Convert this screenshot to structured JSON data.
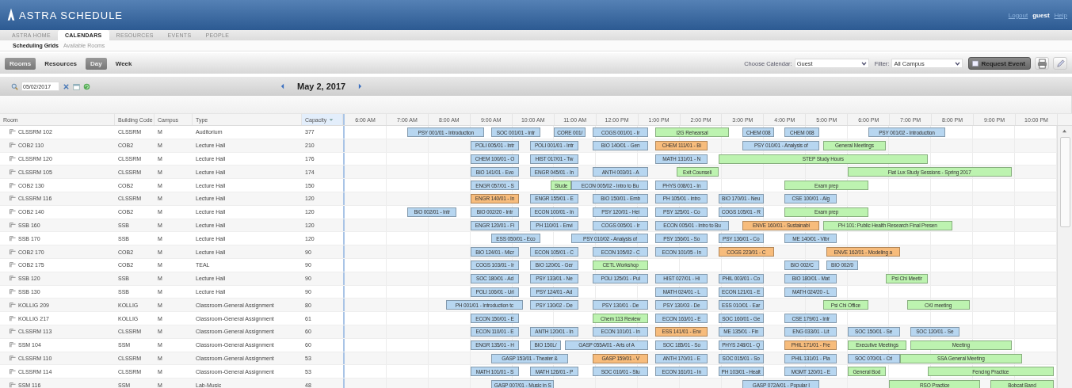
{
  "app": {
    "title": "ASTRA SCHEDULE"
  },
  "user": {
    "logout": "Logout",
    "name": "guest",
    "help": "Help"
  },
  "tabs": [
    {
      "label": "ASTRA HOME",
      "selected": false
    },
    {
      "label": "CALENDARS",
      "selected": true
    },
    {
      "label": "RESOURCES",
      "selected": false
    },
    {
      "label": "EVENTS",
      "selected": false
    },
    {
      "label": "PEOPLE",
      "selected": false
    }
  ],
  "subnav": [
    {
      "label": "Scheduling Grids",
      "selected": true
    },
    {
      "label": "Available Rooms",
      "selected": false
    }
  ],
  "toolbar": {
    "modes": [
      {
        "label": "Rooms",
        "selected": true
      },
      {
        "label": "Resources",
        "selected": false
      }
    ],
    "ranges": [
      {
        "label": "Day",
        "selected": true
      },
      {
        "label": "Week",
        "selected": false
      }
    ],
    "calendar_label": "Choose Calendar:",
    "calendar": "Guest",
    "filter_label": "Filter:",
    "filter": "All Campus",
    "request": "Request Event"
  },
  "date_field": "05/02/2017",
  "date_title": "May 2, 2017",
  "columns": [
    "Room",
    "Building Code",
    "Campus",
    "Type",
    "Capacity"
  ],
  "hours": [
    "6:00 AM",
    "7:00 AM",
    "8:00 AM",
    "9:00 AM",
    "10:00 AM",
    "11:00 AM",
    "12:00 PM",
    "1:00 PM",
    "2:00 PM",
    "3:00 PM",
    "4:00 PM",
    "5:00 PM",
    "6:00 PM",
    "7:00 PM",
    "8:00 PM",
    "9:00 PM",
    "10:00 PM"
  ],
  "rooms": [
    {
      "name": "CLSSRM 102",
      "building": "CLSSRM",
      "campus": "M",
      "type": "Auditorium",
      "capacity": "377",
      "events": [
        {
          "title": "PSY 001/01 - Introduction",
          "color": "#b7d6f0"
        },
        {
          "title": "SOC 001/01 - Intr",
          "color": "#b7d6f0"
        },
        {
          "title": "CORE 001/",
          "color": "#b7d6f0"
        },
        {
          "title": "COGS 001/01 - Ir",
          "color": "#b7d6f0"
        },
        {
          "title": "I2G Rehearsal",
          "color": "#bdf3b0"
        },
        {
          "title": "CHEM 008",
          "color": "#b7d6f0"
        },
        {
          "title": "CHEM 008",
          "color": "#b7d6f0"
        },
        {
          "title": "PSY 001/02 - Introduction",
          "color": "#b7d6f0"
        }
      ]
    },
    {
      "name": "COB2 110",
      "building": "COB2",
      "campus": "M",
      "type": "Lecture Hall",
      "capacity": "210",
      "events": [
        {
          "title": "POLI 005/01 - Intr",
          "color": "#b7d6f0"
        },
        {
          "title": "POLI 001/01 - Intr",
          "color": "#b7d6f0"
        },
        {
          "title": "BIO 140/01 - Gen",
          "color": "#b7d6f0"
        },
        {
          "title": "CHEM 111/01 - Bi",
          "color": "#f7bc7c"
        },
        {
          "title": "PSY 010/01 - Analysis of",
          "color": "#b7d6f0"
        },
        {
          "title": "General Meetings",
          "color": "#bdf3b0"
        }
      ]
    },
    {
      "name": "CLSSRM 120",
      "building": "CLSSRM",
      "campus": "M",
      "type": "Lecture Hall",
      "capacity": "176",
      "events": [
        {
          "title": "CHEM 100/01 - O",
          "color": "#b7d6f0"
        },
        {
          "title": "HIST 017/01 - Tw",
          "color": "#b7d6f0"
        },
        {
          "title": "MATH 131/01 - N",
          "color": "#b7d6f0"
        },
        {
          "title": "STEP Study Hours",
          "color": "#bdf3b0"
        }
      ]
    },
    {
      "name": "CLSSRM 105",
      "building": "CLSSRM",
      "campus": "M",
      "type": "Lecture Hall",
      "capacity": "174",
      "events": [
        {
          "title": "BIO 141/01 - Evo",
          "color": "#b7d6f0"
        },
        {
          "title": "ENGR 045/01 - In",
          "color": "#b7d6f0"
        },
        {
          "title": "ANTH 003/01 - A",
          "color": "#b7d6f0"
        },
        {
          "title": "Exit Counseli",
          "color": "#bdf3b0"
        },
        {
          "title": "Fiat Lux Study Sessions - Spring 2017",
          "color": "#bdf3b0"
        }
      ]
    },
    {
      "name": "COB2 130",
      "building": "COB2",
      "campus": "M",
      "type": "Lecture Hall",
      "capacity": "150",
      "events": [
        {
          "title": "ENGR 057/01 - S",
          "color": "#b7d6f0"
        },
        {
          "title": "Stude",
          "color": "#bdf3b0"
        },
        {
          "title": "ECON 005/02 - Intro to Bu",
          "color": "#b7d6f0"
        },
        {
          "title": "PHYS 008/01 - In",
          "color": "#b7d6f0"
        },
        {
          "title": "Exam prep",
          "color": "#bdf3b0"
        }
      ]
    },
    {
      "name": "CLSSRM 116",
      "building": "CLSSRM",
      "campus": "M",
      "type": "Lecture Hall",
      "capacity": "120",
      "events": [
        {
          "title": "ENGR 140/01 - In",
          "color": "#f7bc7c"
        },
        {
          "title": "ENGR 155/01 - E",
          "color": "#b7d6f0"
        },
        {
          "title": "BIO 150/01 - Emb",
          "color": "#b7d6f0"
        },
        {
          "title": "PH 105/01 - Intro",
          "color": "#b7d6f0"
        },
        {
          "title": "BIO 170/01 - Neu",
          "color": "#b7d6f0"
        },
        {
          "title": "CSE 100/01 - Alg",
          "color": "#b7d6f0"
        }
      ]
    },
    {
      "name": "COB2 140",
      "building": "COB2",
      "campus": "M",
      "type": "Lecture Hall",
      "capacity": "120",
      "events": [
        {
          "title": "BIO 002/01 - Intr",
          "color": "#b7d6f0"
        },
        {
          "title": "BIO 002/20 - Intr",
          "color": "#b7d6f0"
        },
        {
          "title": "ECON 100/01 - In",
          "color": "#b7d6f0"
        },
        {
          "title": "PSY 120/01 - Hei",
          "color": "#b7d6f0"
        },
        {
          "title": "PSY 125/01 - Co",
          "color": "#b7d6f0"
        },
        {
          "title": "COGS 105/01 - R",
          "color": "#b7d6f0"
        },
        {
          "title": "Exam prep",
          "color": "#bdf3b0"
        }
      ]
    },
    {
      "name": "SSB 160",
      "building": "SSB",
      "campus": "M",
      "type": "Lecture Hall",
      "capacity": "120",
      "events": [
        {
          "title": "ENGR 120/01 - Fi",
          "color": "#b7d6f0"
        },
        {
          "title": "PH 110/01 - Envi",
          "color": "#b7d6f0"
        },
        {
          "title": "COGS 005/01 - Ir",
          "color": "#b7d6f0"
        },
        {
          "title": "ECON 005/01 - Intro to Bu",
          "color": "#b7d6f0"
        },
        {
          "title": "ENVE 160/01 - Sustainabi",
          "color": "#f7bc7c"
        },
        {
          "title": "PH 101: Public Health Research Final Presen",
          "color": "#bdf3b0"
        }
      ]
    },
    {
      "name": "SSB 170",
      "building": "SSB",
      "campus": "M",
      "type": "Lecture Hall",
      "capacity": "120",
      "events": [
        {
          "title": "ESS 050/01 - Eco",
          "color": "#b7d6f0"
        },
        {
          "title": "PSY 010/02 - Analysis of",
          "color": "#b7d6f0"
        },
        {
          "title": "PSY 156/01 - So",
          "color": "#b7d6f0"
        },
        {
          "title": "PSY 136/01 - Co",
          "color": "#b7d6f0"
        },
        {
          "title": "ME 140/01 - Vibr",
          "color": "#b7d6f0"
        }
      ]
    },
    {
      "name": "COB2 170",
      "building": "COB2",
      "campus": "M",
      "type": "Lecture Hall",
      "capacity": "90",
      "events": [
        {
          "title": "BIO 124/01 - Micr",
          "color": "#b7d6f0"
        },
        {
          "title": "ECON 105/01 - C",
          "color": "#b7d6f0"
        },
        {
          "title": "ECON 105/02 - C",
          "color": "#b7d6f0"
        },
        {
          "title": "ECON 101/05 - In",
          "color": "#b7d6f0"
        },
        {
          "title": "COGS 223/01 - C",
          "color": "#f7bc7c"
        },
        {
          "title": "ENVE 162/01 - Modeling a",
          "color": "#f7bc7c"
        }
      ]
    },
    {
      "name": "COB2 175",
      "building": "COB2",
      "campus": "M",
      "type": "TEAL",
      "capacity": "90",
      "events": [
        {
          "title": "COGS 103/01 - Ir",
          "color": "#b7d6f0"
        },
        {
          "title": "BIO 120/01 - Ger",
          "color": "#b7d6f0"
        },
        {
          "title": "CETL Workshop",
          "color": "#bdf3b0"
        },
        {
          "title": "BIO 002/C",
          "color": "#b7d6f0"
        },
        {
          "title": "BIO 002/0",
          "color": "#b7d6f0"
        }
      ]
    },
    {
      "name": "SSB 120",
      "building": "SSB",
      "campus": "M",
      "type": "Lecture Hall",
      "capacity": "90",
      "events": [
        {
          "title": "SOC 180/01 - Ad",
          "color": "#b7d6f0"
        },
        {
          "title": "PSY 133/01 - Ne",
          "color": "#b7d6f0"
        },
        {
          "title": "POLI 125/01 - Pul",
          "color": "#b7d6f0"
        },
        {
          "title": "HIST 027/01 - Hi",
          "color": "#b7d6f0"
        },
        {
          "title": "PHIL 003/01 - Co",
          "color": "#b7d6f0"
        },
        {
          "title": "BIO 180/01 - Mat",
          "color": "#b7d6f0"
        },
        {
          "title": "Psi Chi Meetir",
          "color": "#bdf3b0"
        }
      ]
    },
    {
      "name": "SSB 130",
      "building": "SSB",
      "campus": "M",
      "type": "Lecture Hall",
      "capacity": "90",
      "events": [
        {
          "title": "POLI 106/01 - Url",
          "color": "#b7d6f0"
        },
        {
          "title": "PSY 124/01 - Ad",
          "color": "#b7d6f0"
        },
        {
          "title": "MATH 024/01 - L",
          "color": "#b7d6f0"
        },
        {
          "title": "ECON 121/01 - E",
          "color": "#b7d6f0"
        },
        {
          "title": "MATH 024/20 - L",
          "color": "#b7d6f0"
        }
      ]
    },
    {
      "name": "KOLLIG 209",
      "building": "KOLLIG",
      "campus": "M",
      "type": "Classroom-General Assignment",
      "capacity": "80",
      "events": [
        {
          "title": "PH 001/01 - Introduction tc",
          "color": "#b7d6f0"
        },
        {
          "title": "PSY 130/02 - De",
          "color": "#b7d6f0"
        },
        {
          "title": "PSY 130/01 - De",
          "color": "#b7d6f0"
        },
        {
          "title": "PSY 130/03 - De",
          "color": "#b7d6f0"
        },
        {
          "title": "ESS 010/01 - Ear",
          "color": "#b7d6f0"
        },
        {
          "title": "Psi Chi Office",
          "color": "#bdf3b0"
        },
        {
          "title": "CKI meeting",
          "color": "#bdf3b0"
        }
      ]
    },
    {
      "name": "KOLLIG 217",
      "building": "KOLLIG",
      "campus": "M",
      "type": "Classroom-General Assignment",
      "capacity": "61",
      "events": [
        {
          "title": "ECON 150/01 - E",
          "color": "#b7d6f0"
        },
        {
          "title": "Chem 113 Review",
          "color": "#bdf3b0"
        },
        {
          "title": "ECON 163/01 - E",
          "color": "#b7d6f0"
        },
        {
          "title": "SOC 160/01 - Ge",
          "color": "#b7d6f0"
        },
        {
          "title": "CSE 179/01 - Intr",
          "color": "#b7d6f0"
        }
      ]
    },
    {
      "name": "CLSSRM 113",
      "building": "CLSSRM",
      "campus": "M",
      "type": "Classroom-General Assignment",
      "capacity": "60",
      "events": [
        {
          "title": "ECON 110/01 - E",
          "color": "#b7d6f0"
        },
        {
          "title": "ANTH 120/01 - In",
          "color": "#b7d6f0"
        },
        {
          "title": "ECON 101/01 - In",
          "color": "#b7d6f0"
        },
        {
          "title": "ESS 141/01 - Env",
          "color": "#f7bc7c"
        },
        {
          "title": "ME 135/01 - Fin",
          "color": "#b7d6f0"
        },
        {
          "title": "ENG 033/01 - Lit",
          "color": "#b7d6f0"
        },
        {
          "title": "SOC 150/01 - Se",
          "color": "#b7d6f0"
        },
        {
          "title": "SOC 120/01 - Se",
          "color": "#b7d6f0"
        }
      ]
    },
    {
      "name": "SSM 104",
      "building": "SSM",
      "campus": "M",
      "type": "Classroom-General Assignment",
      "capacity": "60",
      "events": [
        {
          "title": "ENGR 135/01 - H",
          "color": "#b7d6f0"
        },
        {
          "title": "BIO 150L/",
          "color": "#b7d6f0"
        },
        {
          "title": "GASP 055A/01 - Arts of A",
          "color": "#b7d6f0"
        },
        {
          "title": "SOC 185/01 - So",
          "color": "#b7d6f0"
        },
        {
          "title": "PHYS 248/01 - Q",
          "color": "#b7d6f0"
        },
        {
          "title": "PHIL 171/01 - Fre",
          "color": "#f7bc7c"
        },
        {
          "title": "Executive Meetings",
          "color": "#bdf3b0"
        },
        {
          "title": "Meeting",
          "color": "#bdf3b0"
        }
      ]
    },
    {
      "name": "CLSSRM 110",
      "building": "CLSSRM",
      "campus": "M",
      "type": "Classroom-General Assignment",
      "capacity": "53",
      "events": [
        {
          "title": "GASP 153/01 - Theater &",
          "color": "#b7d6f0"
        },
        {
          "title": "GASP 159/01 - V",
          "color": "#f7bc7c"
        },
        {
          "title": "ANTH 170/01 - E",
          "color": "#b7d6f0"
        },
        {
          "title": "SOC 015/01 - So",
          "color": "#b7d6f0"
        },
        {
          "title": "PHIL 131/01 - Pla",
          "color": "#b7d6f0"
        },
        {
          "title": "SOC 070/01 - Cri",
          "color": "#b7d6f0"
        },
        {
          "title": "SSA General Meeting",
          "color": "#bdf3b0"
        }
      ]
    },
    {
      "name": "CLSSRM 114",
      "building": "CLSSRM",
      "campus": "M",
      "type": "Classroom-General Assignment",
      "capacity": "53",
      "events": [
        {
          "title": "MATH 101/01 - S",
          "color": "#b7d6f0"
        },
        {
          "title": "MATH 126/01 - P",
          "color": "#b7d6f0"
        },
        {
          "title": "SOC 010/01 - Stu",
          "color": "#b7d6f0"
        },
        {
          "title": "ECON 161/01 - In",
          "color": "#b7d6f0"
        },
        {
          "title": "PH 103/01 - Healt",
          "color": "#b7d6f0"
        },
        {
          "title": "MGMT 120/01 - E",
          "color": "#b7d6f0"
        },
        {
          "title": "General Bod",
          "color": "#bdf3b0"
        },
        {
          "title": "Fencing Practice",
          "color": "#bdf3b0"
        }
      ]
    },
    {
      "name": "SSM 116",
      "building": "SSM",
      "campus": "M",
      "type": "Lab-Music",
      "capacity": "48",
      "events": [
        {
          "title": "GASP 007/01 - Music in S",
          "color": "#b7d6f0"
        },
        {
          "title": "GASP 072A/01 - Popular I",
          "color": "#b7d6f0"
        },
        {
          "title": "RSO Practice",
          "color": "#bdf3b0"
        },
        {
          "title": "Bobcat Band",
          "color": "#bdf3b0"
        }
      ]
    }
  ]
}
